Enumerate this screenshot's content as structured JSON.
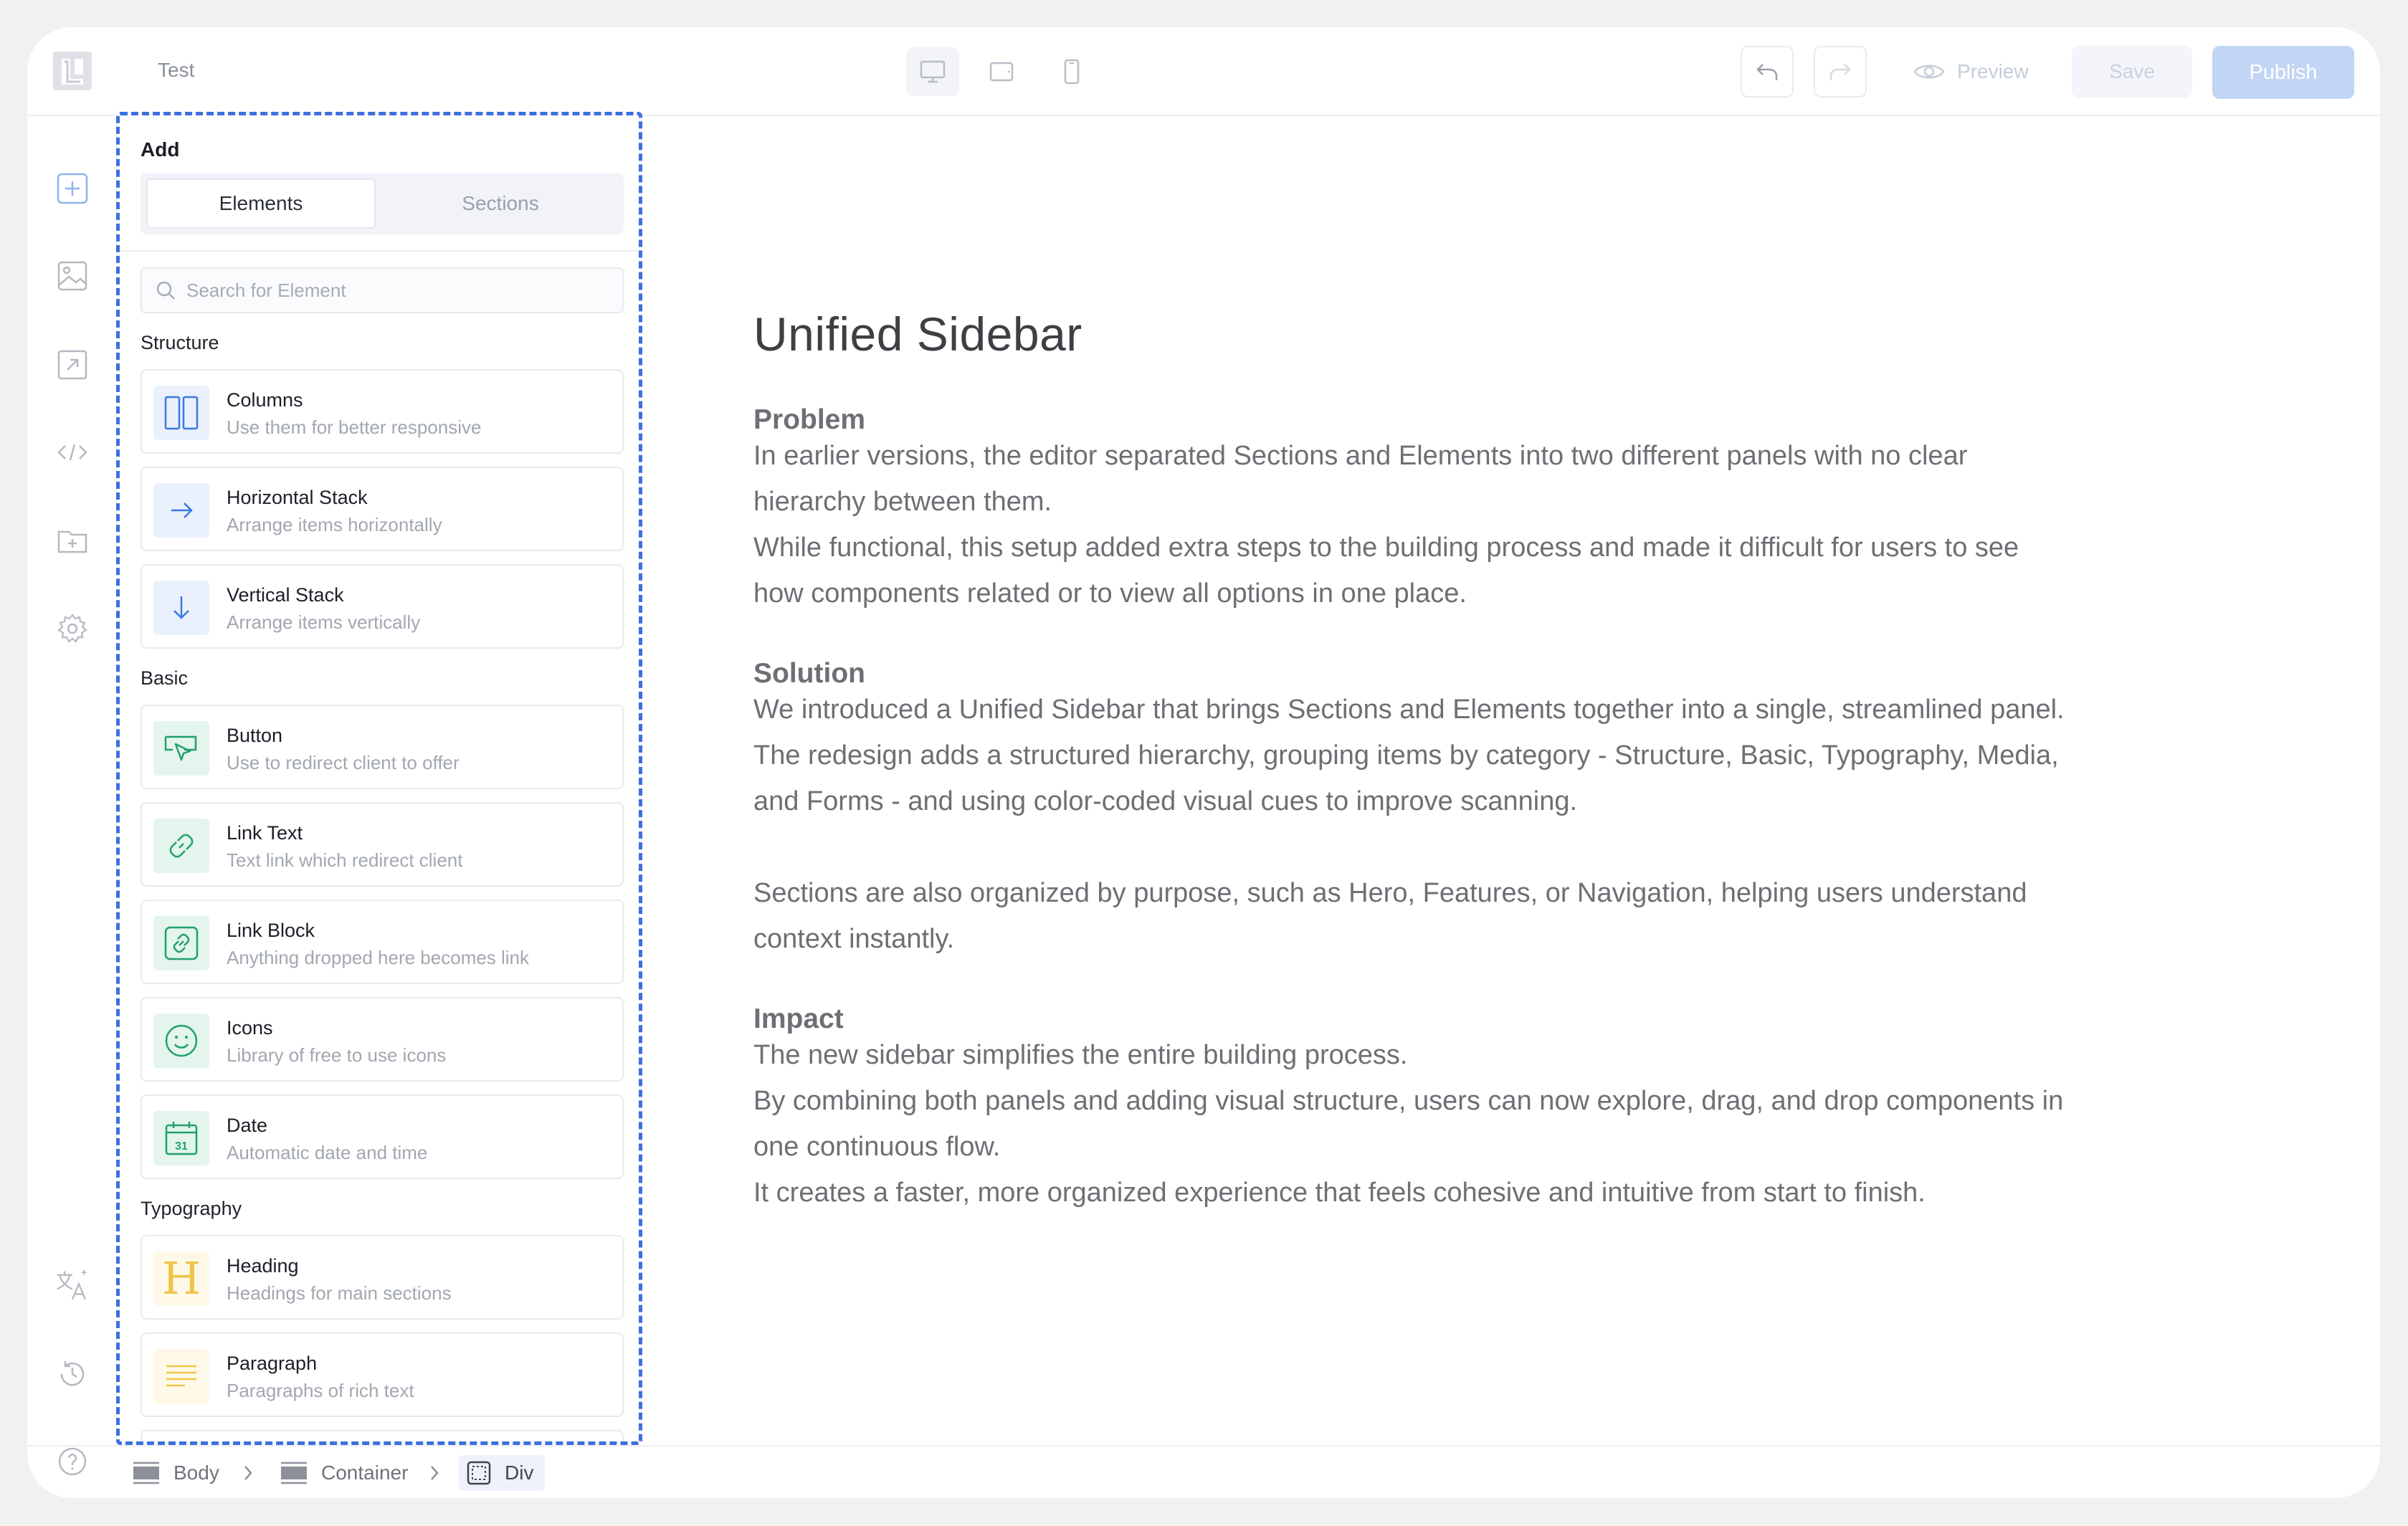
{
  "topbar": {
    "project_name": "Test",
    "device_icons": [
      "desktop-icon",
      "tablet-icon",
      "mobile-icon"
    ],
    "preview_label": "Preview",
    "save_label": "Save",
    "publish_label": "Publish"
  },
  "rail": {
    "top_icons": [
      "add-icon",
      "image-icon",
      "export-icon",
      "code-icon",
      "folder-icon",
      "settings-icon"
    ],
    "bottom_icons": [
      "translate-icon",
      "history-icon",
      "help-icon"
    ]
  },
  "panel": {
    "title": "Add",
    "tabs": [
      {
        "label": "Elements",
        "active": true
      },
      {
        "label": "Sections",
        "active": false
      }
    ],
    "search_placeholder": "Search for Element",
    "categories": [
      {
        "label": "Structure",
        "items": [
          {
            "title": "Columns",
            "subtitle": "Use them for better responsive",
            "icon": "columns-icon"
          },
          {
            "title": "Horizontal Stack",
            "subtitle": "Arrange items horizontally",
            "icon": "arrow-right-icon"
          },
          {
            "title": "Vertical Stack",
            "subtitle": "Arrange items vertically",
            "icon": "arrow-down-icon"
          }
        ]
      },
      {
        "label": "Basic",
        "items": [
          {
            "title": "Button",
            "subtitle": "Use to redirect client to offer",
            "icon": "button-click-icon"
          },
          {
            "title": "Link Text",
            "subtitle": "Text link which redirect client",
            "icon": "link-icon"
          },
          {
            "title": "Link Block",
            "subtitle": "Anything dropped here becomes link",
            "icon": "link-block-icon"
          },
          {
            "title": "Icons",
            "subtitle": "Library of free to use icons",
            "icon": "smiley-icon"
          },
          {
            "title": "Date",
            "subtitle": "Automatic date and time",
            "icon": "calendar-icon",
            "calendar_day": "31"
          }
        ]
      },
      {
        "label": "Typography",
        "items": [
          {
            "title": "Heading",
            "subtitle": "Headings for main sections",
            "icon": "heading-icon",
            "glyph": "H"
          },
          {
            "title": "Paragraph",
            "subtitle": "Paragraphs of rich text",
            "icon": "paragraph-icon"
          }
        ]
      }
    ]
  },
  "content": {
    "title": "Unified Sidebar",
    "sections": [
      {
        "heading": "Problem",
        "paragraphs": [
          "In earlier versions, the editor separated Sections and Elements into two different panels with no clear hierarchy between them.",
          "While functional, this setup added extra steps to the building process and made it difficult for users to see how components related or to view all options in one place."
        ]
      },
      {
        "heading": "Solution",
        "paragraphs": [
          "We introduced a Unified Sidebar that brings Sections and Elements together into a single, streamlined panel. The redesign adds a structured hierarchy, grouping items by category - Structure, Basic, Typography, Media, and Forms - and using color-coded visual cues to improve scanning.",
          "Sections are also organized by purpose, such as Hero, Features, or Navigation, helping users understand context instantly."
        ]
      },
      {
        "heading": "Impact",
        "paragraphs": [
          "The new sidebar simplifies the entire building process.",
          "By combining both panels and adding visual structure, users can now explore, drag, and drop components in one continuous flow.",
          "It creates a faster, more organized experience that feels cohesive and intuitive from start to finish."
        ]
      }
    ]
  },
  "breadcrumb": [
    {
      "label": "Body",
      "active": false
    },
    {
      "label": "Container",
      "active": false
    },
    {
      "label": "Div",
      "active": true
    }
  ],
  "colors": {
    "accent": "#3d6fe0",
    "publish_bg": "#c3d5f4",
    "structure_icon": "#3a78e0",
    "basic_icon": "#21a06a",
    "typography_icon": "#eec545"
  }
}
